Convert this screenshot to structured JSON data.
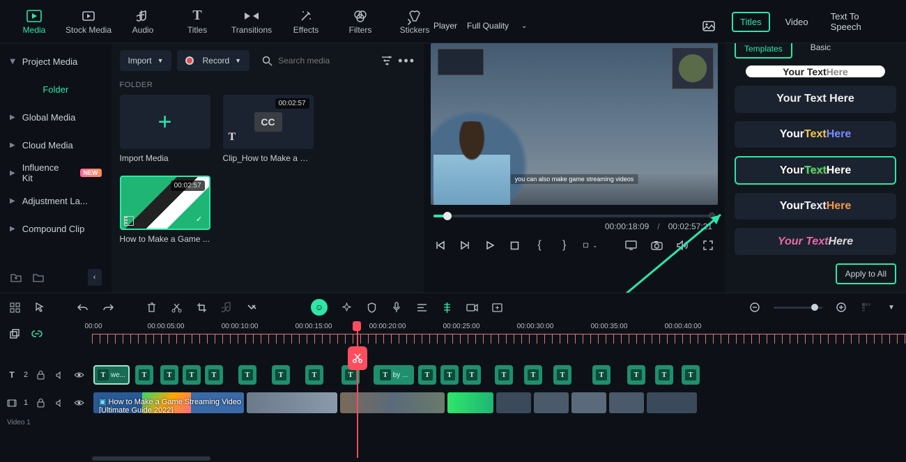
{
  "top_tabs": {
    "media": "Media",
    "stock": "Stock Media",
    "audio": "Audio",
    "titles": "Titles",
    "transitions": "Transitions",
    "effects": "Effects",
    "filters": "Filters",
    "stickers": "Stickers"
  },
  "sidebar": {
    "project_media": "Project Media",
    "folder": "Folder",
    "global_media": "Global Media",
    "cloud_media": "Cloud Media",
    "influence_kit": "Influence Kit",
    "new_badge": "NEW",
    "adjustment": "Adjustment La...",
    "compound": "Compound Clip"
  },
  "browser": {
    "import": "Import",
    "record": "Record",
    "search_placeholder": "Search media",
    "folder_label": "FOLDER",
    "items": [
      {
        "label": "Import Media",
        "type": "import"
      },
      {
        "label": "Clip_How to Make a G...",
        "type": "cc",
        "duration": "00:02:57"
      },
      {
        "label": "How to Make a Game ...",
        "type": "video",
        "duration": "00:02:57"
      }
    ]
  },
  "player": {
    "label": "Player",
    "quality": "Full Quality",
    "caption": "you can also make game streaming videos",
    "current": "00:00:18:09",
    "sep": "/",
    "total": "00:02:57:21"
  },
  "right": {
    "tabs": {
      "titles": "Titles",
      "video": "Video",
      "tts": "Text To Speech"
    },
    "subtabs": {
      "templates": "Templates",
      "basic": "Basic"
    },
    "tpl_text": "Your Text Here",
    "apply": "Apply to All"
  },
  "timeline": {
    "ruler": [
      "00:00",
      "00:00:05:00",
      "00:00:10:00",
      "00:00:15:00",
      "00:00:20:00",
      "00:00:25:00",
      "00:00:30:00",
      "00:00:35:00",
      "00:00:40:00"
    ],
    "track_text": {
      "num": "2",
      "first_label": "we...",
      "by_label": "by ..."
    },
    "track_video": {
      "num": "1",
      "label": "How to Make a Game Streaming Video [Ultimate Guide 2022]"
    },
    "video1": "Video 1"
  }
}
